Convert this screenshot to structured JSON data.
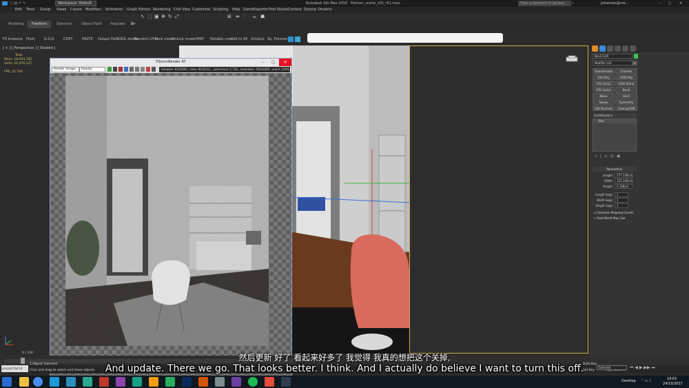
{
  "app": {
    "title": "Autodesk 3ds Max 2016",
    "file": "Patreon_scene_v01_r51.max",
    "workspace": "Workspace: Default",
    "search_placeholder": "Type a keyword or phrase",
    "user": "johannes@cre..."
  },
  "menu": [
    "Edit",
    "Tools",
    "Group",
    "Views",
    "Create",
    "Modifiers",
    "Animation",
    "Graph Editors",
    "Rendering",
    "Civil View",
    "Customize",
    "Scripting",
    "Help",
    "GameExporter",
    "Post Studio",
    "Content",
    "Octane",
    "Ornatrix"
  ],
  "ribbon_tabs": [
    "Modeling",
    "Freeform",
    "Selection",
    "Object Paint",
    "Populate"
  ],
  "ribbon_active": "Freeform",
  "custom_toolbar": [
    "FS Instance",
    "Pivot",
    "G.O.D",
    "COPY",
    "PASTE",
    "Output Path",
    "DSDL delete",
    "Random UVW",
    "Lock model",
    "Unlock model",
    "MKP",
    "Notable com",
    "Add to RE",
    "GrUpick",
    "Sq. Preview"
  ],
  "viewport_label": "[ + ] [ Perspective ] [ Shaded ]",
  "stats": {
    "total_label": "Total",
    "polys_label": "Polys:",
    "polys_value": "18,924,782",
    "verts_label": "Verts:",
    "verts_value": "21,479,127",
    "fps_label": "FPS:",
    "fps_value": "25.704"
  },
  "render_window": {
    "title": "FStormRender RT",
    "render_dropdown": "Render Image",
    "pass_dropdown": "beauty",
    "status": "Samples: 6(25000) , time: 00:03:11 , noise level: 2.718 , resolution: 700x1000 , zoom: 100%, ..."
  },
  "command_panel": {
    "object_name": "Box15140",
    "modifier_list": "Modifier List",
    "modifier_buttons": [
      [
        "TurboSmooth",
        "Chamfer"
      ],
      [
        "Edit Poly",
        "UVW Map"
      ],
      [
        "FFD 2x2x2",
        "UVW Xform"
      ],
      [
        "FFD 3x3x3",
        "Bend"
      ],
      [
        "Noise",
        "Shell"
      ],
      [
        "Sweep",
        "Symmetry"
      ],
      [
        "Edit Normals",
        "UnwrapUVW"
      ]
    ],
    "stack_header": "LimitDisplace",
    "stack_item": "Box",
    "params_title": "Parameters",
    "params": [
      {
        "label": "Length:",
        "value": "277.328cm"
      },
      {
        "label": "Width:",
        "value": "122.349cm"
      },
      {
        "label": "Height:",
        "value": "0.328cm"
      },
      {
        "label": "Length Segs:",
        "value": "1"
      },
      {
        "label": "Width Segs:",
        "value": "1"
      },
      {
        "label": "Height Segs:",
        "value": "1"
      }
    ],
    "checkbox_1": "Generate Mapping Coords.",
    "checkbox_2": "Real-World Map Size"
  },
  "timeline": {
    "frame_counter": "0 / 100"
  },
  "status": {
    "selection": "1 Object Selected",
    "hint": "Click and drag to select and move objects",
    "maxscript": "projectfwild",
    "autokey": "Auto Key",
    "setkey": "Set Key",
    "selected_dropdown": "Selected",
    "key_filters": "Key Filters..."
  },
  "subtitles": {
    "chinese": "然后更新 好了 看起来好多了 我觉得 我真的想把这个关掉,",
    "english": "And update. There we go. That looks better. I think. And I actually do believe I want to turn this off."
  },
  "taskbar": {
    "desktop_label": "Desktop",
    "time": "19:01",
    "date": "24/10/2017"
  },
  "colors": {
    "accent_viewport_border": "#c9b44b",
    "close_button": "#e81123",
    "stats_text": "#d6c36b"
  }
}
